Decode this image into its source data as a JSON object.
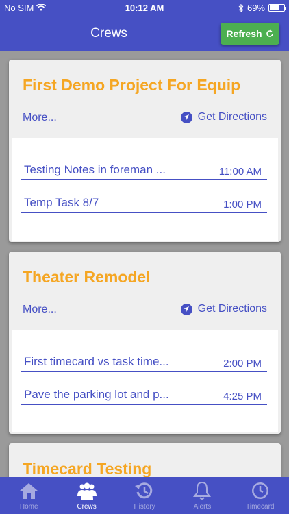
{
  "status_bar": {
    "carrier": "No SIM",
    "time": "10:12 AM",
    "battery": "69%",
    "battery_level": 0.69
  },
  "header": {
    "title": "Crews",
    "refresh_label": "Refresh"
  },
  "cards": [
    {
      "title": "First Demo Project For Equip",
      "more_label": "More...",
      "directions_label": "Get Directions",
      "tasks": [
        {
          "name": "Testing Notes in foreman ...",
          "time": "11:00 AM"
        },
        {
          "name": "Temp Task 8/7",
          "time": "1:00 PM"
        }
      ]
    },
    {
      "title": "Theater Remodel",
      "more_label": "More...",
      "directions_label": "Get Directions",
      "tasks": [
        {
          "name": "First timecard vs task time...",
          "time": "2:00 PM"
        },
        {
          "name": "Pave the parking lot and p...",
          "time": "4:25 PM"
        }
      ]
    },
    {
      "title": "Timecard Testing"
    }
  ],
  "tabs": [
    {
      "label": "Home",
      "icon": "home-icon"
    },
    {
      "label": "Crews",
      "icon": "crews-icon",
      "active": true
    },
    {
      "label": "History",
      "icon": "history-icon"
    },
    {
      "label": "Alerts",
      "icon": "bell-icon"
    },
    {
      "label": "Timecard",
      "icon": "clock-icon"
    }
  ],
  "colors": {
    "brand": "#4650c4",
    "accent": "#f5a623",
    "refresh": "#4caf50",
    "background": "#9a9a9a"
  }
}
